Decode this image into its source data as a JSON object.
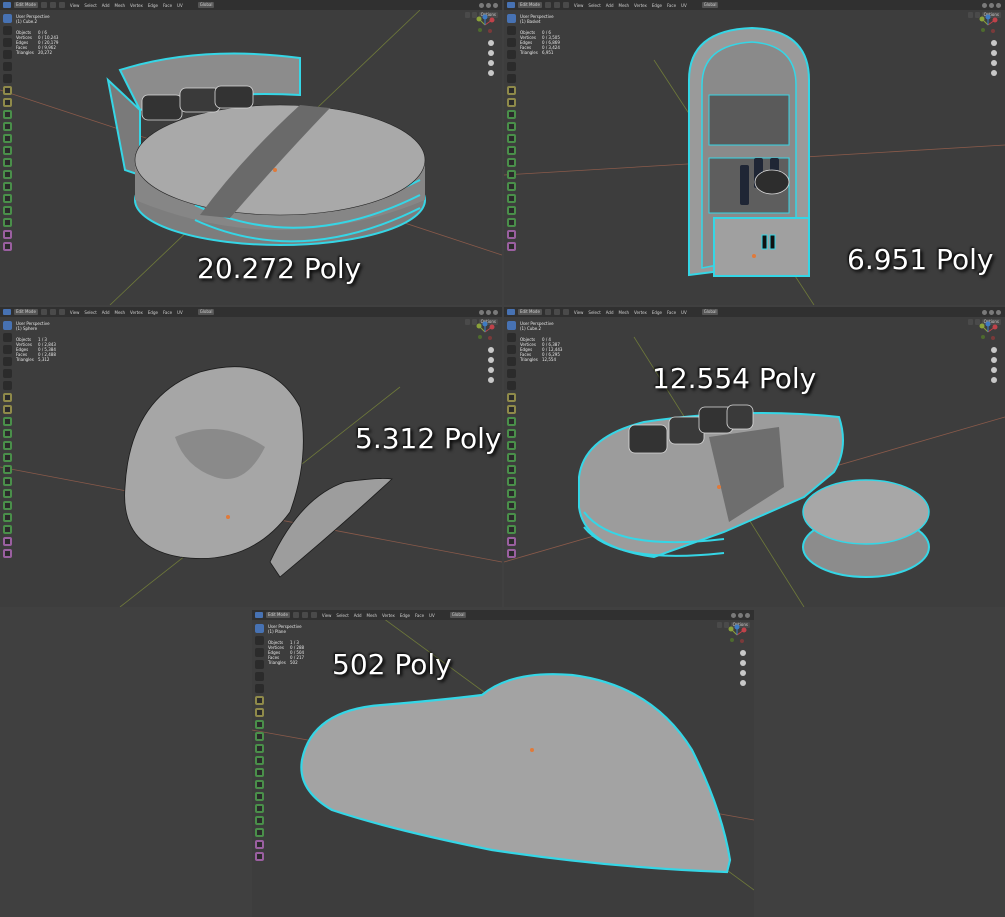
{
  "menus": [
    "View",
    "Select",
    "Add",
    "Mesh",
    "Vertex",
    "Edge",
    "Face",
    "UV"
  ],
  "mode_label": "Edit Mode",
  "orientation_label": "Global",
  "options_label": "Options",
  "colors": {
    "viewport_bg": "#3d3d3d",
    "header": "#303030",
    "accent": "#4772b3",
    "edge_highlight": "#35d6e6",
    "mesh": "#9a9a9a",
    "x_axis": "#c0424a",
    "y_axis": "#8ba33a"
  },
  "viewports": [
    {
      "view": "User Perspective",
      "object": "(1) Cube.2",
      "stats": [
        [
          "Objects",
          "0 / 6"
        ],
        [
          "Vertices",
          "0 / 10,243"
        ],
        [
          "Edges",
          "0 / 20,179"
        ],
        [
          "Faces",
          "0 / 9,962"
        ],
        [
          "Triangles",
          "20,272"
        ]
      ],
      "poly_label": "20.272 Poly",
      "model": "round-bed-icon"
    },
    {
      "view": "User Perspective",
      "object": "(1) Basket",
      "stats": [
        [
          "Objects",
          "0 / 6"
        ],
        [
          "Vertices",
          "0 / 3,505"
        ],
        [
          "Edges",
          "0 / 6,869"
        ],
        [
          "Faces",
          "0 / 3,424"
        ],
        [
          "Triangles",
          "6,951"
        ]
      ],
      "poly_label": "6.951 Poly",
      "model": "arched-shelf-icon"
    },
    {
      "view": "User Perspective",
      "object": "(1) Sphere",
      "stats": [
        [
          "Objects",
          "1 / 3"
        ],
        [
          "Vertices",
          "0 / 2,843"
        ],
        [
          "Edges",
          "0 / 5,384"
        ],
        [
          "Faces",
          "0 / 2,488"
        ],
        [
          "Triangles",
          "5,312"
        ]
      ],
      "poly_label": "5.312 Poly",
      "model": "bean-bag-icon"
    },
    {
      "view": "User Perspective",
      "object": "(1) Cube.2",
      "stats": [
        [
          "Objects",
          "0 / 4"
        ],
        [
          "Vertices",
          "0 / 6,387"
        ],
        [
          "Edges",
          "0 / 12,443"
        ],
        [
          "Faces",
          "0 / 6,295"
        ],
        [
          "Triangles",
          "12,554"
        ]
      ],
      "poly_label": "12.554 Poly",
      "model": "sofa-ottoman-icon"
    },
    {
      "view": "User Perspective",
      "object": "(1) Plane",
      "stats": [
        [
          "Objects",
          "1 / 3"
        ],
        [
          "Vertices",
          "0 / 288"
        ],
        [
          "Edges",
          "0 / 504"
        ],
        [
          "Faces",
          "0 / 217"
        ],
        [
          "Triangles",
          "502"
        ]
      ],
      "poly_label": "502 Poly",
      "model": "heart-rug-icon"
    }
  ]
}
